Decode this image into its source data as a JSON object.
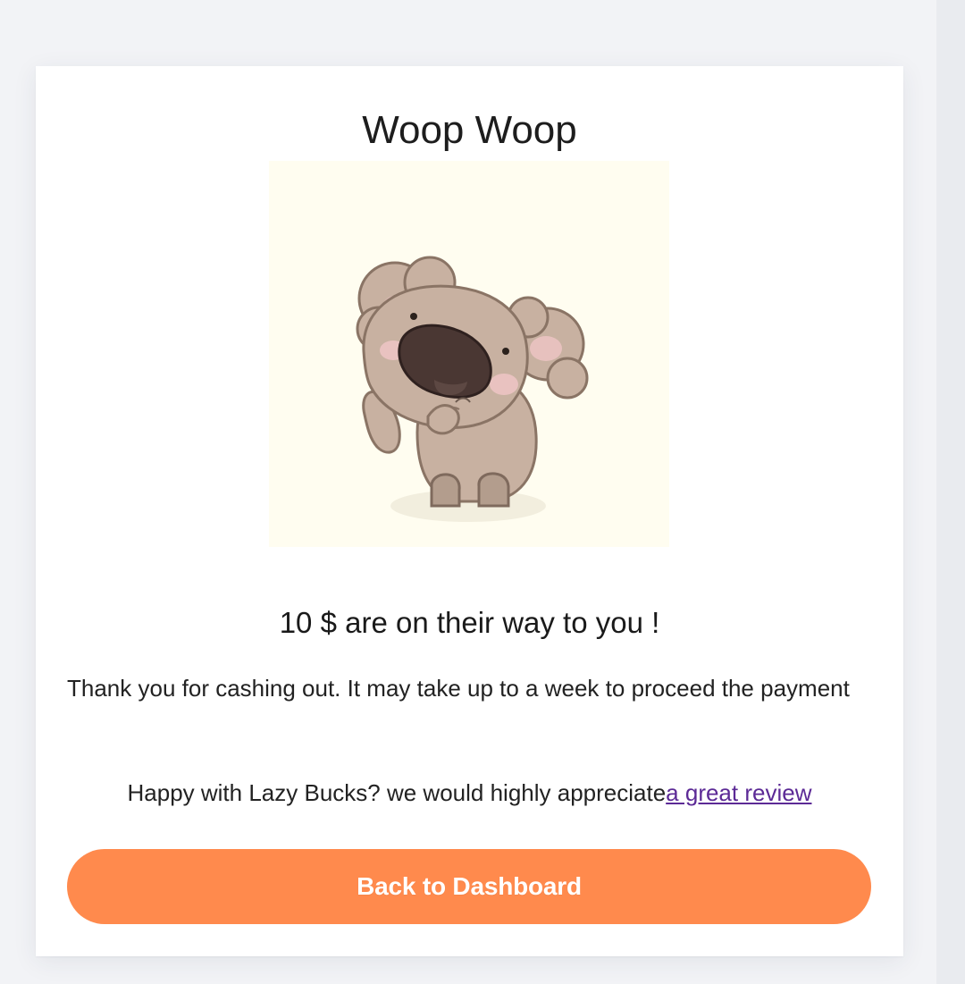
{
  "card": {
    "title": "Woop Woop",
    "illustration": "koala-cheering",
    "headline": "10 $ are on their way to you !",
    "message": "Thank you for cashing out. It may take up to a week to proceed the payment",
    "review_prefix": "Happy with Lazy Bucks? we would highly appreciate",
    "review_link": "a great review",
    "button_label": "Back to Dashboard"
  },
  "colors": {
    "button": "#ff8a4d",
    "link": "#5c2a96",
    "background": "#f2f3f6",
    "illustration_bg": "#fffdf0"
  }
}
